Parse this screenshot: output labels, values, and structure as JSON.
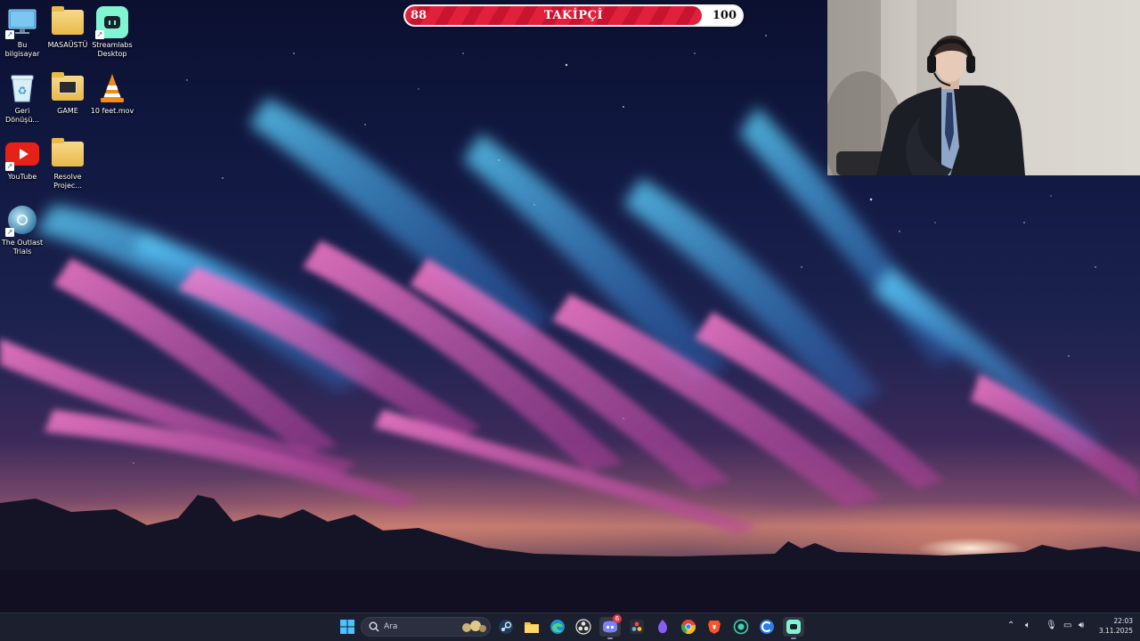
{
  "follower_goal": {
    "current": "88",
    "title": "TAKİPÇİ",
    "target": "100",
    "progress_fraction": 0.88
  },
  "desktop_icons": [
    {
      "label": "Bu bilgisayar",
      "icon": "monitor-icon"
    },
    {
      "label": "MASAÜSTÜ",
      "icon": "folder-icon"
    },
    {
      "label": "Streamlabs Desktop",
      "icon": "streamlabs-icon"
    },
    {
      "label": "Geri Dönüşü...",
      "icon": "recycle-bin-icon"
    },
    {
      "label": "GAME",
      "icon": "folder-icon"
    },
    {
      "label": "10 feet.mov",
      "icon": "vlc-cone-icon"
    },
    {
      "label": "YouTube",
      "icon": "youtube-icon"
    },
    {
      "label": "Resolve Projec...",
      "icon": "folder-icon"
    },
    {
      "label": "The Outlast Trials",
      "icon": "outlast-icon"
    }
  ],
  "taskbar": {
    "search_placeholder": "Ara",
    "discord_badge": "6",
    "apps": [
      "start-icon",
      "search-icon",
      "steam-icon",
      "file-explorer-icon",
      "edge-icon",
      "obs-icon",
      "discord-icon",
      "davinci-resolve-icon",
      "app-purple-icon",
      "chrome-icon",
      "brave-icon",
      "app-teal-icon",
      "app-blue-icon",
      "streamlabs-icon"
    ],
    "tray": [
      "chevron-up-icon",
      "speaker-icon",
      "microphone-icon",
      "display-icon",
      "volume-icon"
    ],
    "time": "22:03",
    "date": "3.11.2025"
  },
  "colors": {
    "bar_fill": "#e2203b",
    "taskbar_bg": "#1c1f2e"
  }
}
